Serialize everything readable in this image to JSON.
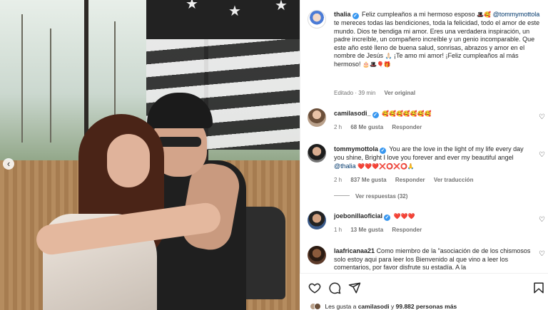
{
  "post": {
    "image_alt": "",
    "author": "thalia",
    "caption_text": "Feliz cumpleaños a mi hermoso esposo",
    "caption_emoji_1": "🎩🥰",
    "caption_mention": "@tommymottola",
    "caption_body": " te mereces todas las bendiciones, toda la felicidad, todo el amor de este mundo. Dios te bendiga mi amor. Eres una verdadera inspiración, un padre increíble, un compañero increíble y un genio incomparable. Que este año esté lleno de buena salud, sonrisas, abrazos y amor en el nombre de Jesús",
    "caption_emoji_2": "🙏🏻",
    "caption_tail": " ¡Te amo mi amor! ¡Feliz cumpleaños al más hermoso!",
    "caption_emoji_3": "🎂🎩🎈🎁",
    "edited_label": "Editado",
    "time": "39 min",
    "see_translation": "Ver original"
  },
  "comments": [
    {
      "username": "camilasodi_",
      "verified": true,
      "text": "",
      "emoji": "🥰🥰🥰🥰🥰🥰🥰",
      "time": "2 h",
      "likes": "68 Me gusta",
      "reply": "Responder"
    },
    {
      "username": "tommymottola",
      "verified": true,
      "text": "You are the love in the light of my life every day you shine, Bright I love you forever and ever my beautiful angel ",
      "mention": "@thalia",
      "emoji": "❤️❤️❤️❌⭕❌⭕🙏",
      "time": "2 h",
      "likes": "837 Me gusta",
      "reply": "Responder",
      "translation": "Ver traducción",
      "view_replies": "Ver respuestas (32)"
    },
    {
      "username": "joebonillaoficial",
      "verified": true,
      "text": "",
      "emoji": "❤️❤️❤️",
      "time": "1 h",
      "likes": "13 Me gusta",
      "reply": "Responder"
    },
    {
      "username": "laafricanaa21",
      "verified": false,
      "text": "Como miembro de la \"asociación de de los chismosos solo estoy aqui para leer los Bienvenido al que vino a leer los comentarios, por favor disfrute su estadía. A la"
    }
  ],
  "actions": {
    "like": "heart-icon",
    "comment": "comment-icon",
    "share": "share-icon",
    "save": "bookmark-icon"
  },
  "likes": {
    "prefix": "Les gusta a",
    "user": "camilasodi",
    "connector": "y",
    "count": "99.882 personas más"
  },
  "colors": {
    "verified": "#3897f0",
    "mention": "#00376b",
    "muted": "#737373",
    "text": "#262626"
  }
}
